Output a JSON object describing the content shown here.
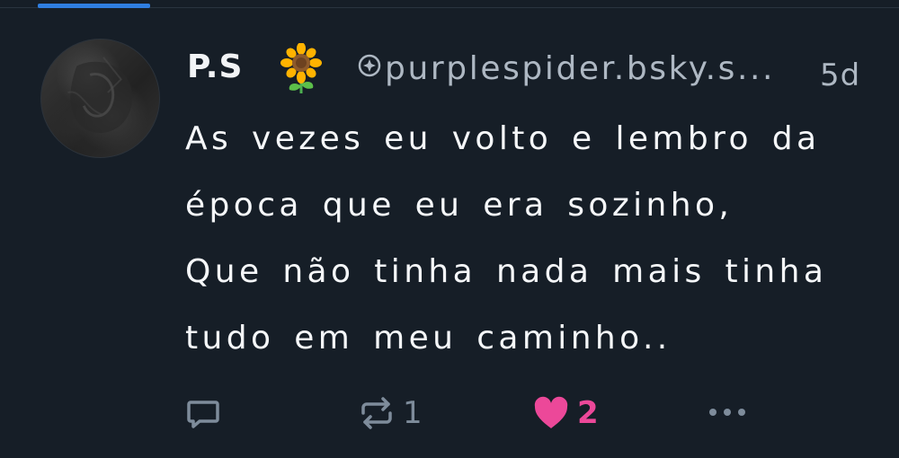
{
  "post": {
    "author": {
      "display_name": "P.S",
      "display_name_emoji": "sunflower",
      "handle": "purplespider.bsky.s...",
      "handle_icon": "verified-handle-icon"
    },
    "timestamp": "5d",
    "text_lines": [
      "As vezes eu volto e lembro da",
      "época que eu era sozinho,",
      "Que não tinha nada mais tinha",
      "tudo em meu caminho.."
    ]
  },
  "actions": {
    "reply": {
      "icon": "reply-icon",
      "count": ""
    },
    "repost": {
      "icon": "repost-icon",
      "count": "1"
    },
    "like": {
      "icon": "heart-icon",
      "count": "2",
      "liked": true
    },
    "more": {
      "icon": "more-icon"
    }
  },
  "colors": {
    "background": "#161e27",
    "accent": "#2f7ee0",
    "like": "#ec4899",
    "muted": "#7e8c9b"
  }
}
